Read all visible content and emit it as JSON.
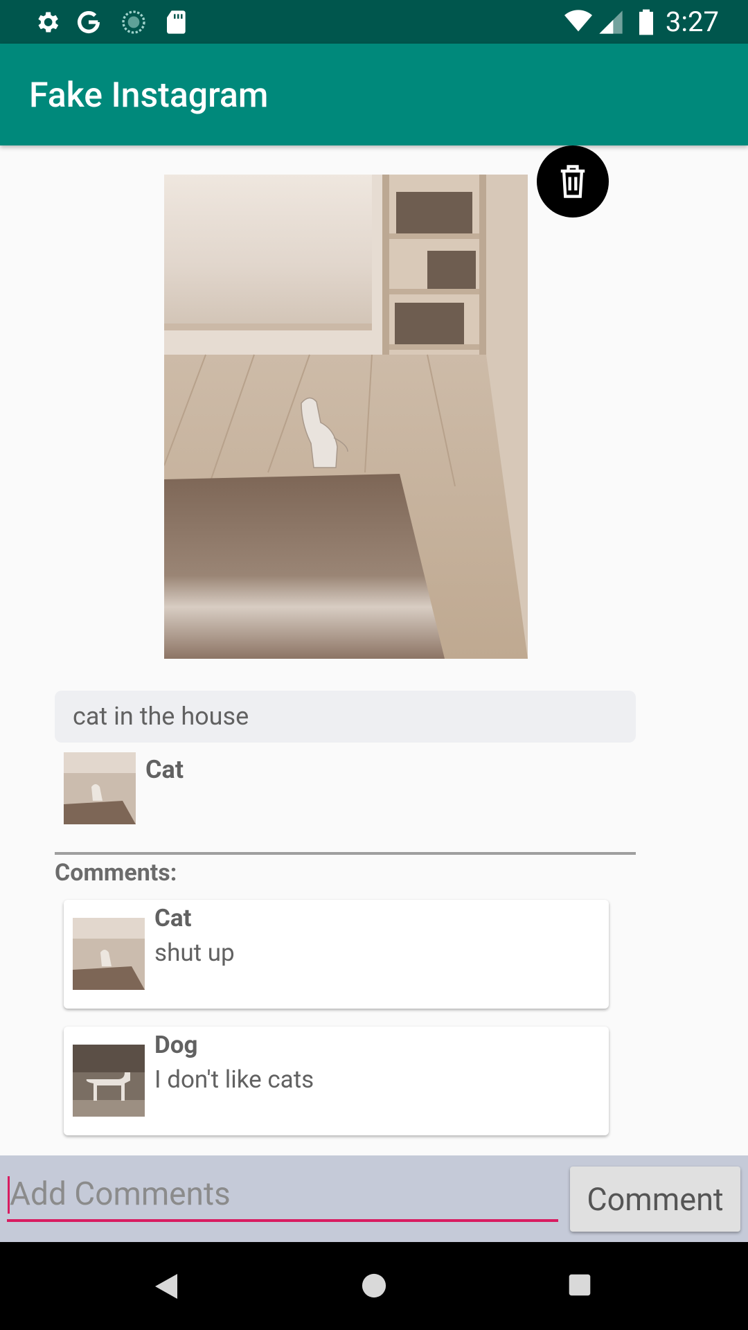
{
  "status_bar": {
    "time": "3:27",
    "left_icons": [
      "settings-icon",
      "google-icon",
      "sync-icon",
      "sd-card-icon"
    ],
    "right_icons": [
      "wifi-icon",
      "signal-icon",
      "battery-icon"
    ]
  },
  "app_bar": {
    "title": "Fake Instagram"
  },
  "post": {
    "caption": "cat in the house",
    "author": "Cat",
    "delete_icon": "trash-icon"
  },
  "comments_section": {
    "label": "Comments:",
    "items": [
      {
        "name": "Cat",
        "text": "shut up"
      },
      {
        "name": "Dog",
        "text": "I don't like cats"
      }
    ]
  },
  "input_bar": {
    "placeholder": "Add Comments",
    "button_label": "Comment"
  },
  "colors": {
    "status_bar": "#00564d",
    "app_bar": "#00897b",
    "accent": "#d81b60",
    "input_bar_bg": "#c5cad8"
  },
  "nav_bar": {
    "icons": [
      "back-icon",
      "home-icon",
      "recents-icon"
    ]
  }
}
